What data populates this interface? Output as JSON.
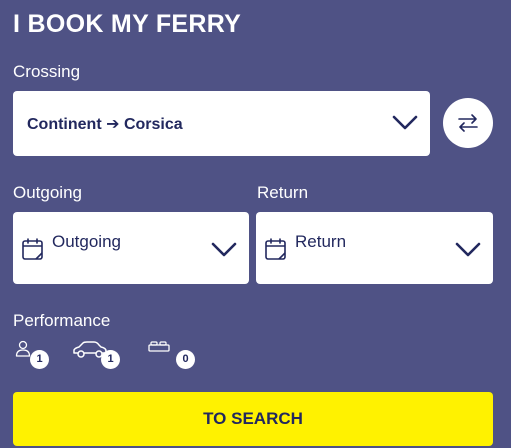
{
  "header": {
    "title": "I BOOK MY FERRY"
  },
  "crossing": {
    "label": "Crossing",
    "value": "Continent ➔ Corsica"
  },
  "swap": {
    "icon": "swap-arrows-icon"
  },
  "outgoing": {
    "label": "Outgoing",
    "placeholder": "Outgoing",
    "icon": "calendar-icon"
  },
  "return": {
    "label": "Return",
    "placeholder": "Return",
    "icon": "calendar-icon"
  },
  "performance": {
    "label": "Performance",
    "passengers": {
      "icon": "person-icon",
      "count": "1"
    },
    "vehicles": {
      "icon": "car-icon",
      "count": "1"
    },
    "cabins": {
      "icon": "bed-icon",
      "count": "0"
    }
  },
  "search": {
    "label": "TO SEARCH"
  },
  "colors": {
    "background": "#4f5285",
    "text_dark": "#22285e",
    "search_button": "#fff200"
  }
}
